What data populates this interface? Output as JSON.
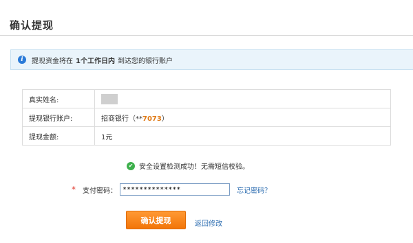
{
  "page": {
    "title": "确认提现"
  },
  "notice": {
    "icon": "info-icon",
    "prefix": "提现资金将在",
    "highlight": "1个工作日内",
    "suffix": "到达您的银行账户"
  },
  "details": {
    "rows": [
      {
        "label": "真实姓名:",
        "value": ""
      },
      {
        "label": "提现银行账户:",
        "bank": "招商银行",
        "open": "（**",
        "number": "7073",
        "close": "）"
      },
      {
        "label": "提现金额:",
        "value": "1元"
      }
    ]
  },
  "success": {
    "icon": "check-icon",
    "text": "安全设置检测成功！无需短信校验。"
  },
  "password": {
    "required_mark": "*",
    "label": "支付密码：",
    "value": "**************",
    "forgot": "忘记密码？"
  },
  "actions": {
    "confirm": "确认提现",
    "back": "返回修改"
  },
  "colors": {
    "accent": "#f27508",
    "link": "#2b6cb0",
    "info": "#2a7ad8",
    "success": "#3db04c"
  }
}
